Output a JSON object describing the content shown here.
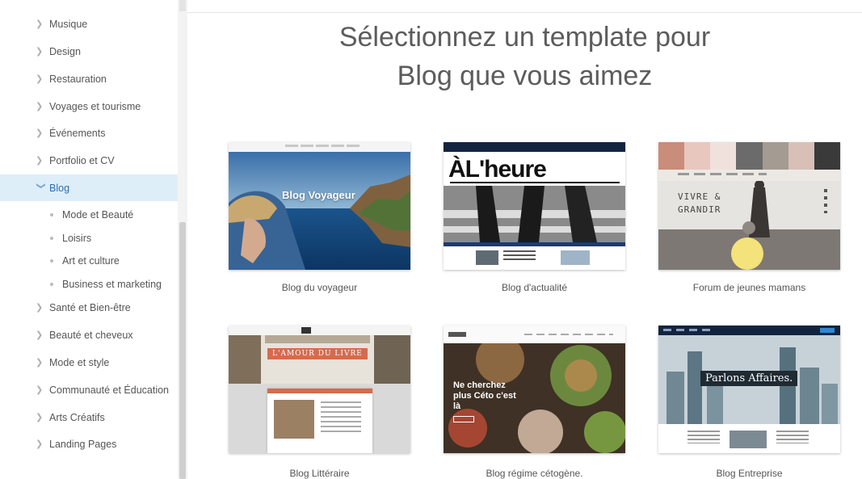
{
  "sidebar": {
    "items": [
      {
        "label": "Musique"
      },
      {
        "label": "Design"
      },
      {
        "label": "Restauration"
      },
      {
        "label": "Voyages et tourisme"
      },
      {
        "label": "Événements"
      },
      {
        "label": "Portfolio et CV"
      },
      {
        "label": "Blog"
      },
      {
        "label": "Santé et Bien-être"
      },
      {
        "label": "Beauté et cheveux"
      },
      {
        "label": "Mode et style"
      },
      {
        "label": "Communauté et Éducation"
      },
      {
        "label": "Arts Créatifs"
      },
      {
        "label": "Landing Pages"
      }
    ],
    "active_item": "Blog",
    "subitems": [
      {
        "label": "Mode et Beauté"
      },
      {
        "label": "Loisirs"
      },
      {
        "label": "Art et culture"
      },
      {
        "label": "Business et marketing"
      }
    ]
  },
  "heading": {
    "line1": "Sélectionnez un template pour",
    "line2": "Blog que vous aimez"
  },
  "templates": [
    {
      "caption": "Blog du voyageur",
      "thumb_title": "Blog Voyageur"
    },
    {
      "caption": "Blog d'actualité",
      "thumb_title": "ÀL'heure"
    },
    {
      "caption": "Forum de jeunes mamans",
      "thumb_title": "VIVRE & GRANDIR"
    },
    {
      "caption": "Blog Littéraire",
      "thumb_title": "L'AMOUR DU LIVRE"
    },
    {
      "caption": "Blog régime cétogène.",
      "thumb_title": "Ne cherchez plus Céto c'est là"
    },
    {
      "caption": "Blog Entreprise",
      "thumb_title": "Parlons Affaires."
    }
  ],
  "colors": {
    "active_bg": "#deeef9",
    "active_text": "#2b6fb3",
    "heading": "#5c5c5c"
  }
}
